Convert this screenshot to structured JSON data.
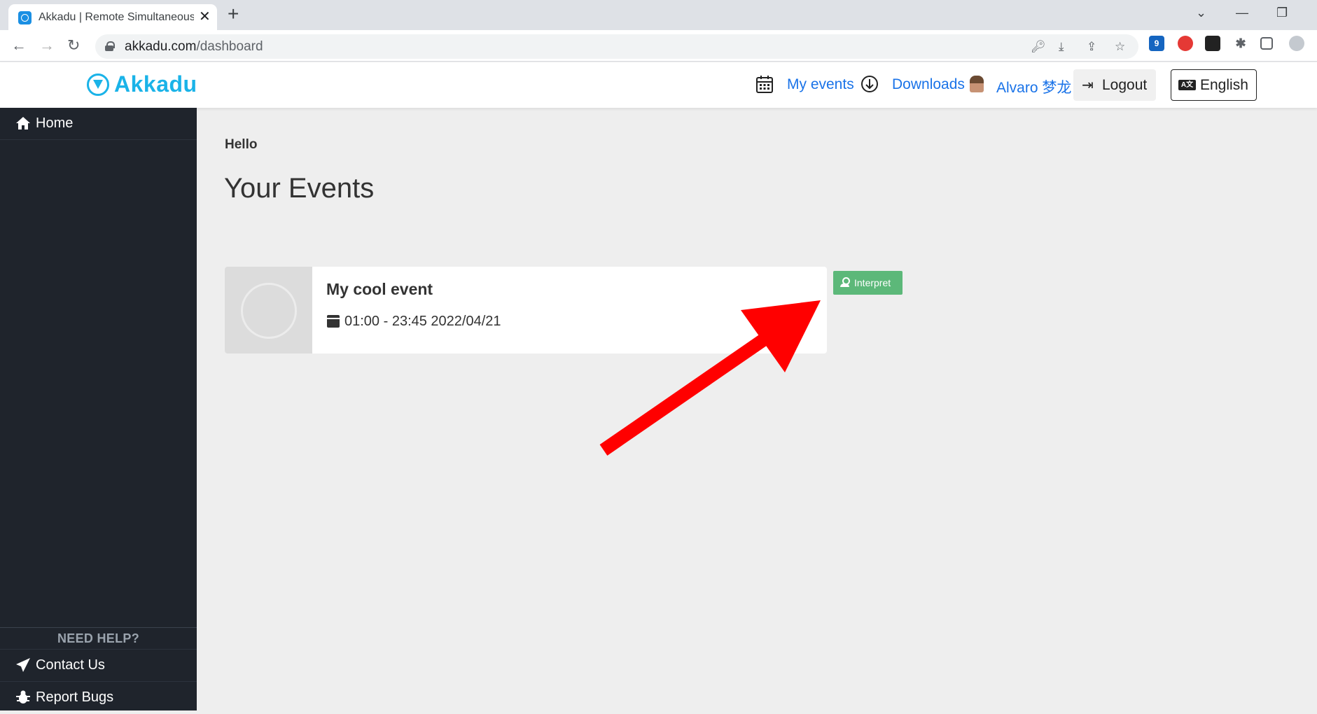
{
  "browser": {
    "tab_title": "Akkadu | Remote Simultaneous Interpretation",
    "tab_close": "✕",
    "new_tab": "+",
    "url_host": "akkadu.com",
    "url_path": "/dashboard",
    "nav_back": "←",
    "nav_forward": "→",
    "nav_reload": "↻",
    "ext_badge": "9",
    "colors": {
      "chrome_bg": "#dee1e6",
      "omnibox_bg": "#f1f3f4"
    }
  },
  "header": {
    "logo_text": "Akkadu",
    "my_events_label": "My events",
    "downloads_label": "Downloads",
    "user_name": "Alvaro 梦龙",
    "logout_label": "Logout",
    "language_label": "English",
    "lang_icon_text": "A文",
    "colors": {
      "brand": "#1ab3e8",
      "link": "#1a73e8"
    }
  },
  "sidebar": {
    "home_label": "Home",
    "help_title": "NEED HELP?",
    "contact_label": "Contact Us",
    "report_label": "Report Bugs",
    "colors": {
      "bg": "#1f242c"
    }
  },
  "main": {
    "greeting": "Hello",
    "title": "Your Events",
    "events": [
      {
        "name": "My cool event",
        "time": "01:00 - 23:45 2022/04/21",
        "action_label": "Interpret",
        "action_color": "#5cb879"
      }
    ]
  },
  "annotation": {
    "arrow_color": "#ff0000"
  }
}
